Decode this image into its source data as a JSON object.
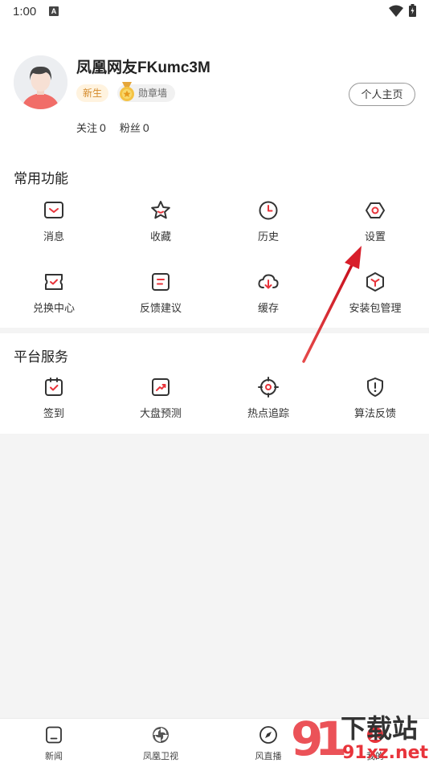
{
  "status_bar": {
    "time": "1:00",
    "notif_icon": "a-box-icon"
  },
  "profile": {
    "username": "凤凰网友FKumc3M",
    "badge_new": "新生",
    "badge_medal": "勋章墙",
    "homepage_button": "个人主页",
    "follow_label": "关注",
    "follow_count": "0",
    "fans_label": "粉丝",
    "fans_count": "0"
  },
  "common": {
    "title": "常用功能",
    "items": [
      {
        "label": "消息",
        "icon": "message-icon"
      },
      {
        "label": "收藏",
        "icon": "star-icon"
      },
      {
        "label": "历史",
        "icon": "clock-icon"
      },
      {
        "label": "设置",
        "icon": "gear-icon"
      },
      {
        "label": "兑换中心",
        "icon": "ticket-icon"
      },
      {
        "label": "反馈建议",
        "icon": "feedback-icon"
      },
      {
        "label": "缓存",
        "icon": "cloud-download-icon"
      },
      {
        "label": "安装包管理",
        "icon": "package-icon"
      }
    ]
  },
  "platform": {
    "title": "平台服务",
    "items": [
      {
        "label": "签到",
        "icon": "check-in-icon"
      },
      {
        "label": "大盘预测",
        "icon": "trend-icon"
      },
      {
        "label": "热点追踪",
        "icon": "crosshair-icon"
      },
      {
        "label": "算法反馈",
        "icon": "shield-alert-icon"
      }
    ]
  },
  "bottom_nav": [
    {
      "label": "新闻",
      "icon": "news-icon"
    },
    {
      "label": "凤凰卫视",
      "icon": "phoenix-icon"
    },
    {
      "label": "风直播",
      "icon": "compass-icon"
    },
    {
      "label": "我的",
      "icon": "profile-icon"
    }
  ],
  "watermark": {
    "text_main": "下载站",
    "text_url": "91xz.net"
  },
  "colors": {
    "accent": "#e8343b",
    "arrow": "#d81e2a"
  }
}
